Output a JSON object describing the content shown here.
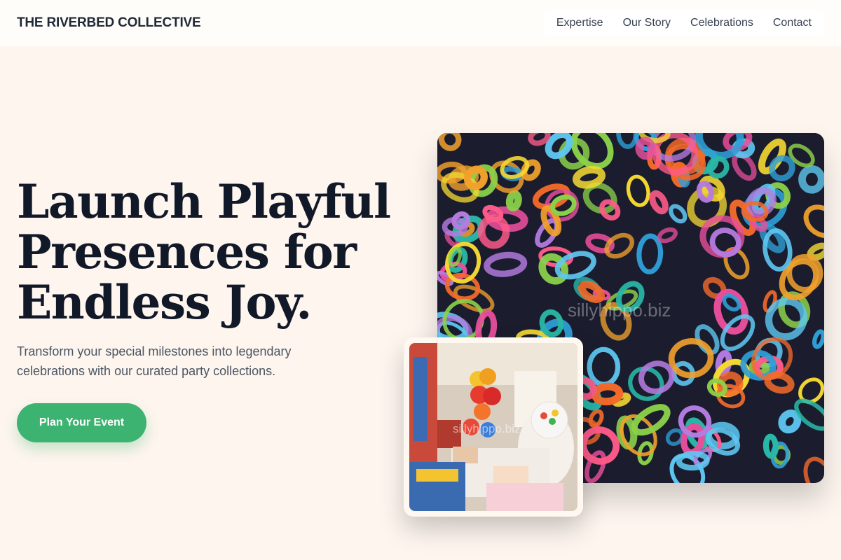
{
  "brand": {
    "name": "THE RIVERBED COLLECTIVE"
  },
  "nav": {
    "items": [
      {
        "label": "Expertise"
      },
      {
        "label": "Our Story"
      },
      {
        "label": "Celebrations"
      },
      {
        "label": "Contact"
      }
    ]
  },
  "hero": {
    "title": "Launch Playful Presences for Endless Joy.",
    "subtitle": "Transform your special milestones into legendary celebrations with our curated party collections.",
    "cta_label": "Plan Your Event"
  },
  "images": {
    "main_watermark": "sillyhippo.biz",
    "secondary_watermark": "sillyhippo.biz"
  },
  "colors": {
    "background": "#fdf5ee",
    "accent_green": "#3cb371",
    "heading": "#111827",
    "body_text": "#4b5563"
  }
}
